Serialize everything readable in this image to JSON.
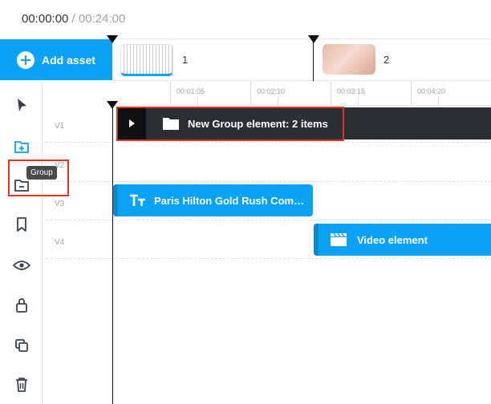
{
  "header": {
    "current_time": "00:00:00",
    "separator": " / ",
    "total_time": "00:24:00"
  },
  "add_asset": {
    "label": "Add asset"
  },
  "scenes": [
    {
      "number": "1"
    },
    {
      "number": "2"
    }
  ],
  "ruler": {
    "ticks": [
      "00:01:05",
      "00:02:10",
      "00:03:15",
      "00:04:20"
    ]
  },
  "tracks": [
    "V1",
    "V2",
    "V3",
    "V4"
  ],
  "toolbar": {
    "tools": [
      "select-tool",
      "add-group-icon",
      "ungroup-icon",
      "bookmark-icon",
      "visibility-icon",
      "lock-icon",
      "duplicate-icon",
      "delete-icon"
    ],
    "tooltip": "Group"
  },
  "elements": {
    "group": {
      "label": "New Group element: 2 items"
    },
    "text": {
      "label": "Paris Hilton Gold Rush Com…"
    },
    "video": {
      "label": "Video element"
    }
  },
  "colors": {
    "accent": "#0aa2f5",
    "dark": "#2b2e33",
    "highlight": "#e03322"
  }
}
